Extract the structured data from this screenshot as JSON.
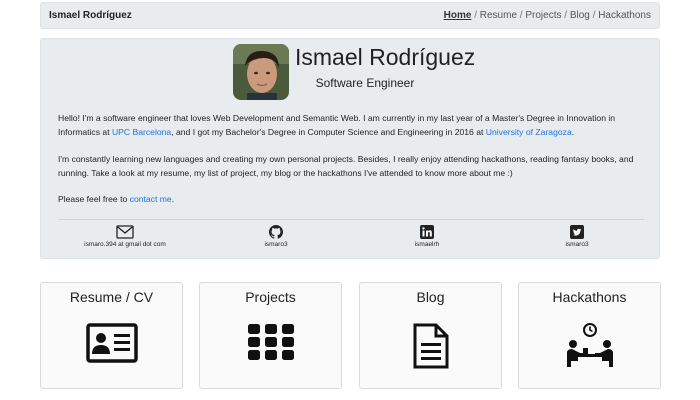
{
  "header": {
    "brand": "Ismael Rodríguez",
    "breadcrumb": {
      "home": "Home",
      "items": [
        "Resume",
        "Projects",
        "Blog",
        "Hackathons"
      ]
    }
  },
  "profile": {
    "name": "Ismael Rodríguez",
    "role": "Software Engineer",
    "bio": {
      "p1_a": "Hello! I'm a software engineer that loves Web Development and Semantic Web. I am currently in my last year of a Master's Degree in Innovation in Informatics at ",
      "p1_link1": "UPC Barcelona",
      "p1_b": ", and I got my Bachelor's Degree in Computer Science and Engineering in 2016 at ",
      "p1_link2": "University of Zaragoza",
      "p1_c": ".",
      "p2": "I'm constantly learning new languages and creating my own personal projects. Besides, I really enjoy attending hackathons, reading fantasy books, and running. Take a look at my resume, my list of project, my blog or the hackathons I've attended to know more about me :)",
      "p3_a": "Please feel free to ",
      "p3_link": "contact me",
      "p3_b": "."
    },
    "contacts": [
      {
        "icon": "envelope-icon",
        "label": "ismaro.394 at gmail dot com"
      },
      {
        "icon": "github-icon",
        "label": "ismaro3"
      },
      {
        "icon": "linkedin-icon",
        "label": "ismaelrh"
      },
      {
        "icon": "twitter-icon",
        "label": "ismaro3"
      }
    ]
  },
  "cards": [
    {
      "title": "Resume / CV",
      "icon": "id-card-icon"
    },
    {
      "title": "Projects",
      "icon": "grid-icon"
    },
    {
      "title": "Blog",
      "icon": "document-icon"
    },
    {
      "title": "Hackathons",
      "icon": "people-meeting-icon"
    }
  ],
  "colors": {
    "link": "#1a73e8",
    "panel_bg": "#e9ecef"
  }
}
